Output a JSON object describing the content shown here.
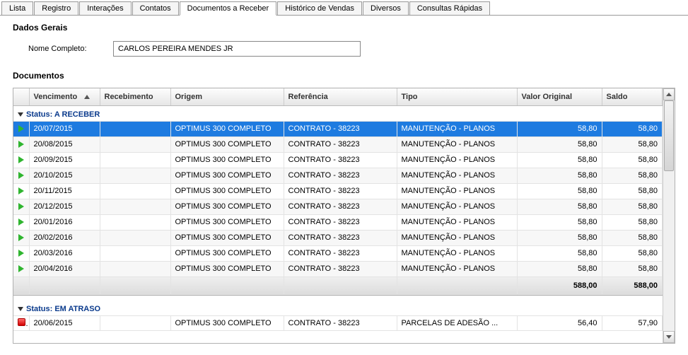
{
  "tabs": [
    "Lista",
    "Registro",
    "Interações",
    "Contatos",
    "Documentos a Receber",
    "Histórico de Vendas",
    "Diversos",
    "Consultas Rápidas"
  ],
  "active_tab": 4,
  "section_general": "Dados Gerais",
  "label_fullname": "Nome Completo:",
  "fullname_value": "CARLOS PEREIRA MENDES JR",
  "section_docs": "Documentos",
  "columns": {
    "venc": "Vencimento",
    "receb": "Recebimento",
    "orig": "Origem",
    "ref": "Referência",
    "tipo": "Tipo",
    "valor": "Valor Original",
    "saldo": "Saldo"
  },
  "group_a": {
    "label": "Status: A RECEBER",
    "rows": [
      {
        "venc": "20/07/2015",
        "receb": "",
        "orig": "OPTIMUS 300 COMPLETO",
        "ref": "CONTRATO - 38223",
        "tipo": "MANUTENÇÃO - PLANOS",
        "valor": "58,80",
        "saldo": "58,80",
        "selected": true
      },
      {
        "venc": "20/08/2015",
        "receb": "",
        "orig": "OPTIMUS 300 COMPLETO",
        "ref": "CONTRATO - 38223",
        "tipo": "MANUTENÇÃO - PLANOS",
        "valor": "58,80",
        "saldo": "58,80"
      },
      {
        "venc": "20/09/2015",
        "receb": "",
        "orig": "OPTIMUS 300 COMPLETO",
        "ref": "CONTRATO - 38223",
        "tipo": "MANUTENÇÃO - PLANOS",
        "valor": "58,80",
        "saldo": "58,80"
      },
      {
        "venc": "20/10/2015",
        "receb": "",
        "orig": "OPTIMUS 300 COMPLETO",
        "ref": "CONTRATO - 38223",
        "tipo": "MANUTENÇÃO - PLANOS",
        "valor": "58,80",
        "saldo": "58,80"
      },
      {
        "venc": "20/11/2015",
        "receb": "",
        "orig": "OPTIMUS 300 COMPLETO",
        "ref": "CONTRATO - 38223",
        "tipo": "MANUTENÇÃO - PLANOS",
        "valor": "58,80",
        "saldo": "58,80"
      },
      {
        "venc": "20/12/2015",
        "receb": "",
        "orig": "OPTIMUS 300 COMPLETO",
        "ref": "CONTRATO - 38223",
        "tipo": "MANUTENÇÃO - PLANOS",
        "valor": "58,80",
        "saldo": "58,80"
      },
      {
        "venc": "20/01/2016",
        "receb": "",
        "orig": "OPTIMUS 300 COMPLETO",
        "ref": "CONTRATO - 38223",
        "tipo": "MANUTENÇÃO - PLANOS",
        "valor": "58,80",
        "saldo": "58,80"
      },
      {
        "venc": "20/02/2016",
        "receb": "",
        "orig": "OPTIMUS 300 COMPLETO",
        "ref": "CONTRATO - 38223",
        "tipo": "MANUTENÇÃO - PLANOS",
        "valor": "58,80",
        "saldo": "58,80"
      },
      {
        "venc": "20/03/2016",
        "receb": "",
        "orig": "OPTIMUS 300 COMPLETO",
        "ref": "CONTRATO - 38223",
        "tipo": "MANUTENÇÃO - PLANOS",
        "valor": "58,80",
        "saldo": "58,80"
      },
      {
        "venc": "20/04/2016",
        "receb": "",
        "orig": "OPTIMUS 300 COMPLETO",
        "ref": "CONTRATO - 38223",
        "tipo": "MANUTENÇÃO - PLANOS",
        "valor": "58,80",
        "saldo": "58,80"
      }
    ],
    "total_valor": "588,00",
    "total_saldo": "588,00"
  },
  "group_b": {
    "label": "Status: EM ATRASO",
    "rows": [
      {
        "venc": "20/06/2015",
        "receb": "",
        "orig": "OPTIMUS 300 COMPLETO",
        "ref": "CONTRATO - 38223",
        "tipo": "PARCELAS DE ADESÃO ...",
        "valor": "56,40",
        "saldo": "57,90"
      }
    ]
  }
}
